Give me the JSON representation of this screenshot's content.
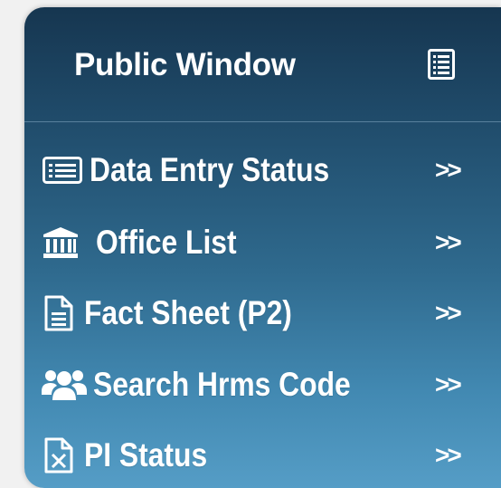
{
  "panel": {
    "title": "Public Window",
    "title_icon": "list-doc-icon"
  },
  "menu": {
    "items": [
      {
        "label": "Data Entry Status",
        "icon": "list-card-icon",
        "arrow": ">>"
      },
      {
        "label": "Office List",
        "icon": "bank-icon",
        "arrow": ">>"
      },
      {
        "label": "Fact Sheet (P2)",
        "icon": "document-icon",
        "arrow": ">>"
      },
      {
        "label": "Search Hrms Code",
        "icon": "users-icon",
        "arrow": ">>"
      },
      {
        "label": "PI Status",
        "icon": "excel-file-icon",
        "arrow": ">>"
      }
    ]
  },
  "colors": {
    "gradient_top": "#163650",
    "gradient_bottom": "#559dc6",
    "text": "#ffffff",
    "page_bg": "#f1f1f1"
  }
}
